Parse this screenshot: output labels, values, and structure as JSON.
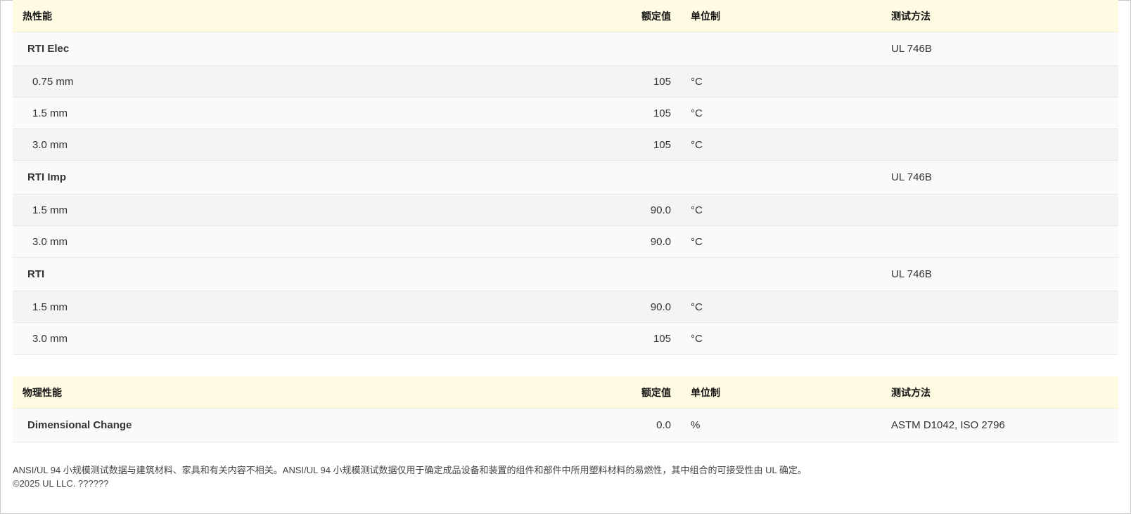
{
  "thermal": {
    "header": {
      "name": "热性能",
      "value": "额定值",
      "unit": "单位制",
      "method": "测试方法"
    },
    "rows": [
      {
        "type": "group",
        "name": "RTI Elec",
        "value": "",
        "unit": "",
        "method": "UL 746B"
      },
      {
        "type": "sub",
        "name": "0.75 mm",
        "value": "105",
        "unit": "°C",
        "method": ""
      },
      {
        "type": "sub",
        "name": "1.5 mm",
        "value": "105",
        "unit": "°C",
        "method": ""
      },
      {
        "type": "sub",
        "name": "3.0 mm",
        "value": "105",
        "unit": "°C",
        "method": ""
      },
      {
        "type": "group",
        "name": "RTI Imp",
        "value": "",
        "unit": "",
        "method": "UL 746B"
      },
      {
        "type": "sub",
        "name": "1.5 mm",
        "value": "90.0",
        "unit": "°C",
        "method": ""
      },
      {
        "type": "sub",
        "name": "3.0 mm",
        "value": "90.0",
        "unit": "°C",
        "method": ""
      },
      {
        "type": "group",
        "name": "RTI",
        "value": "",
        "unit": "",
        "method": "UL 746B"
      },
      {
        "type": "sub",
        "name": "1.5 mm",
        "value": "90.0",
        "unit": "°C",
        "method": ""
      },
      {
        "type": "sub",
        "name": "3.0 mm",
        "value": "105",
        "unit": "°C",
        "method": ""
      }
    ]
  },
  "physical": {
    "header": {
      "name": "物理性能",
      "value": "额定值",
      "unit": "单位制",
      "method": "测试方法"
    },
    "rows": [
      {
        "type": "group",
        "name": "Dimensional Change",
        "value": "0.0",
        "unit": "%",
        "method": "ASTM D1042, ISO 2796"
      }
    ]
  },
  "footer": {
    "disclaimer": "ANSI/UL 94 小规模测试数据与建筑材料、家具和有关内容不相关。ANSI/UL 94 小规模测试数据仅用于确定成品设备和装置的组件和部件中所用塑料材料的易燃性，其中组合的可接受性由 UL 确定。",
    "copyright": "©2025 UL LLC. ??????"
  }
}
